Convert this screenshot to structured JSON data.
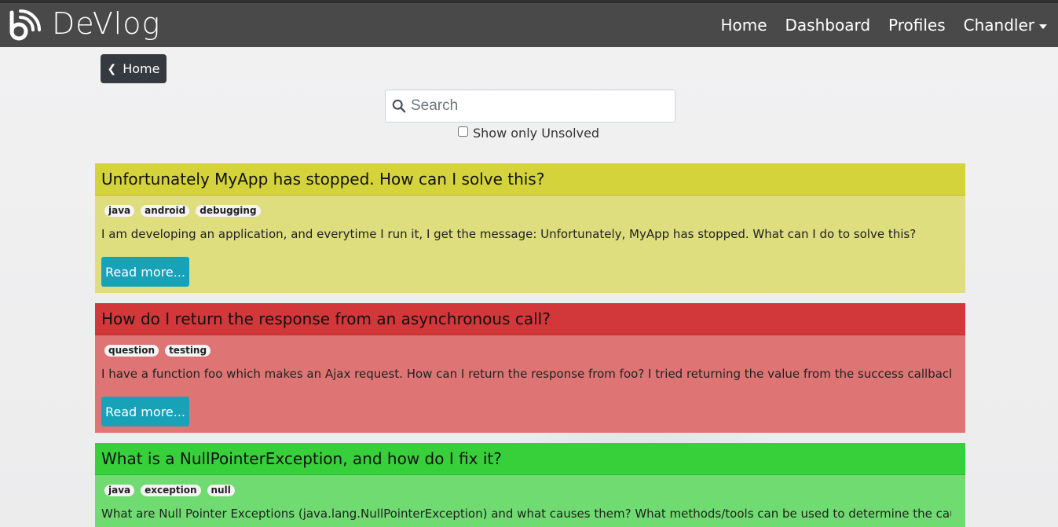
{
  "brand": {
    "name": "DeVlog"
  },
  "nav": {
    "items": [
      {
        "label": "Home"
      },
      {
        "label": "Dashboard"
      },
      {
        "label": "Profiles"
      }
    ],
    "user": "Chandler"
  },
  "home_button": {
    "label": "Home"
  },
  "search": {
    "placeholder": "Search"
  },
  "filter": {
    "label": "Show only Unsolved"
  },
  "read_more_label": "Read more...",
  "colors": {
    "navbar": "#4a4949",
    "yellow_header": "#d4d33c",
    "yellow_body": "#dede7e",
    "red_header": "#d2373a",
    "red_body": "#de7574",
    "green_header": "#37d03a",
    "green_body": "#6fdb70",
    "button": "#17a2b8"
  },
  "questions": [
    {
      "title": "Unfortunately MyApp has stopped. How can I solve this?",
      "tags": [
        "java",
        "android",
        "debugging"
      ],
      "excerpt": "I am developing an application, and everytime I run it, I get the message: Unfortunately, MyApp has stopped. What can I do to solve this?"
    },
    {
      "title": "How do I return the response from an asynchronous call?",
      "tags": [
        "question",
        "testing"
      ],
      "excerpt": "I have a function foo which makes an Ajax request. How can I return the response from foo? I tried returning the value from the success callback, as well ..."
    },
    {
      "title": "What is a NullPointerException, and how do I fix it?",
      "tags": [
        "java",
        "exception",
        "null"
      ],
      "excerpt": "What are Null Pointer Exceptions (java.lang.NullPointerException) and what causes them? What methods/tools can be used to determine the cause so tha..."
    }
  ]
}
